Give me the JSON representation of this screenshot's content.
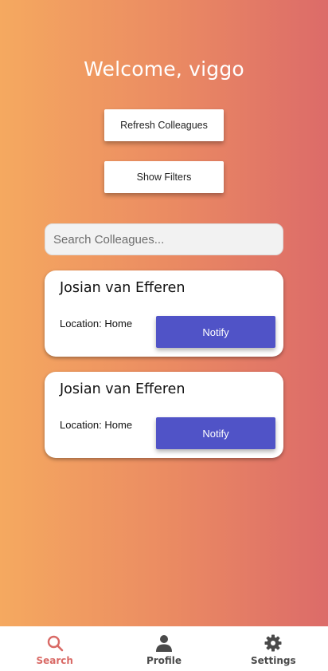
{
  "header": {
    "welcome": "Welcome, viggo"
  },
  "actions": {
    "refresh_label": "Refresh Colleagues",
    "filters_label": "Show Filters"
  },
  "search": {
    "placeholder": "Search Colleagues...",
    "value": ""
  },
  "colleagues": [
    {
      "name": "Josian van Efferen",
      "location": "Location: Home",
      "action": "Notify"
    },
    {
      "name": "Josian van Efferen",
      "location": "Location: Home",
      "action": "Notify"
    }
  ],
  "nav": {
    "items": [
      {
        "label": "Search",
        "icon": "search-icon",
        "active": true
      },
      {
        "label": "Profile",
        "icon": "person-icon",
        "active": false
      },
      {
        "label": "Settings",
        "icon": "gear-icon",
        "active": false
      }
    ]
  },
  "colors": {
    "gradient_start": "#f5a960",
    "gradient_end": "#dc6b69",
    "notify_button": "#5053c7",
    "active_nav": "#d96a66"
  }
}
